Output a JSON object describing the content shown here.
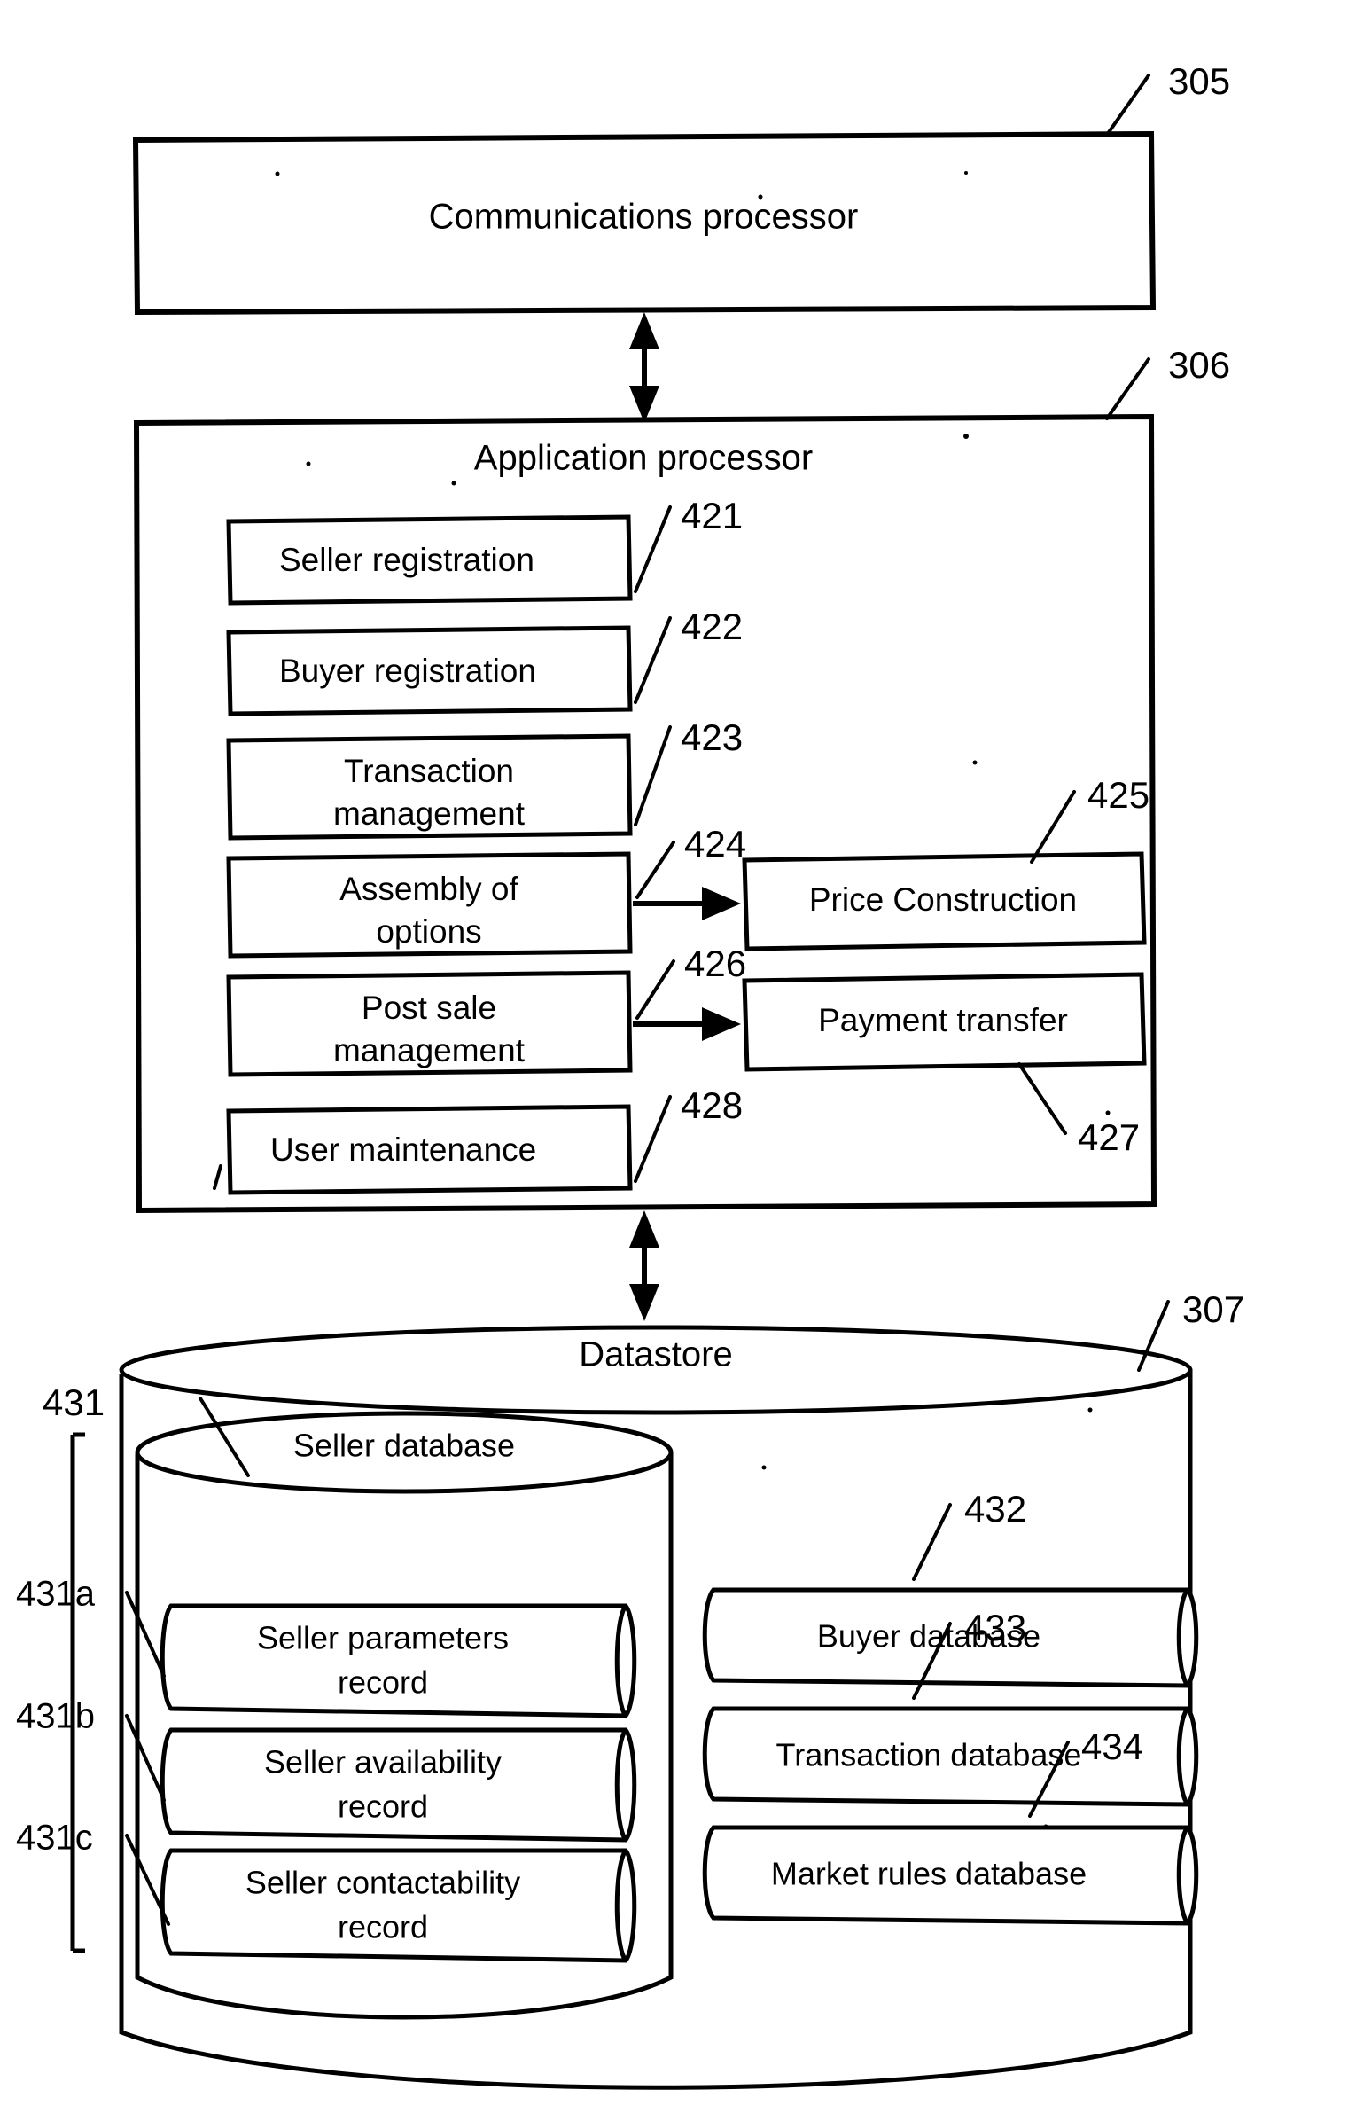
{
  "figure": {
    "type": "patent-block-diagram",
    "background_color": "#ffffff",
    "line_color": "#000000"
  },
  "communications_processor": {
    "label": "Communications processor",
    "ref": "305"
  },
  "application_processor": {
    "label": "Application processor",
    "ref": "306",
    "modules": [
      {
        "label": "Seller registration",
        "ref": "421"
      },
      {
        "label": "Buyer registration",
        "ref": "422"
      },
      {
        "label": "Transaction management",
        "line1": "Transaction",
        "line2": "management",
        "ref": "423"
      },
      {
        "label": "Assembly of options",
        "line1": "Assembly of",
        "line2": "options",
        "ref": "424"
      },
      {
        "label": "Post sale management",
        "line1": "Post sale",
        "line2": "management",
        "ref": "426"
      },
      {
        "label": "User maintenance",
        "ref": "428"
      }
    ],
    "outputs": [
      {
        "label": "Price Construction",
        "ref": "425"
      },
      {
        "label": "Payment transfer",
        "ref": "427"
      }
    ]
  },
  "datastore": {
    "label": "Datastore",
    "ref": "307",
    "seller_database": {
      "label": "Seller database",
      "ref": "431",
      "records": [
        {
          "label": "Seller parameters record",
          "line1": "Seller parameters",
          "line2": "record",
          "ref": "431a"
        },
        {
          "label": "Seller availability record",
          "line1": "Seller availability",
          "line2": "record",
          "ref": "431b"
        },
        {
          "label": "Seller contactability record",
          "line1": "Seller contactability",
          "line2": "record",
          "ref": "431c"
        }
      ]
    },
    "other_databases": [
      {
        "label": "Buyer database",
        "ref": "432"
      },
      {
        "label": "Transaction database",
        "ref": "433"
      },
      {
        "label": "Market rules database",
        "ref": "434"
      }
    ]
  },
  "connectors": [
    {
      "name": "comms-to-app",
      "style": "double-headed-vertical-arrow"
    },
    {
      "name": "app-to-datastore",
      "style": "double-headed-vertical-arrow"
    },
    {
      "name": "assembly-to-price",
      "style": "single-arrow-right"
    },
    {
      "name": "postsale-to-payment",
      "style": "single-arrow-right"
    }
  ]
}
